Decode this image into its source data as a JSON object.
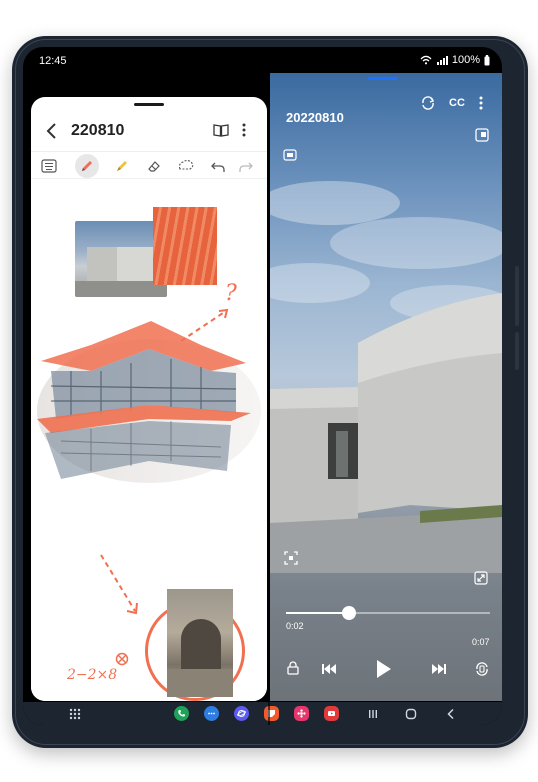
{
  "status_bar": {
    "time": "12:45",
    "battery": "100%"
  },
  "notes": {
    "title": "220810",
    "toolbar": [
      "keyboard-icon",
      "pen-icon",
      "highlighter-icon",
      "eraser-icon",
      "lasso-icon",
      "undo-icon",
      "redo-icon"
    ],
    "annotation_formula": "2−2×8",
    "annotation_question": "?"
  },
  "video": {
    "title": "20220810",
    "cc_label": "CC",
    "time_current": "0:02",
    "time_total": "0:07",
    "progress": 0.31
  },
  "taskbar": {
    "apps": [
      {
        "name": "phone",
        "color": "#1fa35a"
      },
      {
        "name": "messages",
        "color": "#2f7de1"
      },
      {
        "name": "internet",
        "color": "#5b5cf0"
      },
      {
        "name": "notes",
        "color": "#f25a2c"
      },
      {
        "name": "gallery",
        "color": "#e8356b"
      },
      {
        "name": "video",
        "color": "#e23a3a"
      }
    ]
  },
  "colors": {
    "accent": "#1e72ff",
    "sketch": "#f07050"
  }
}
